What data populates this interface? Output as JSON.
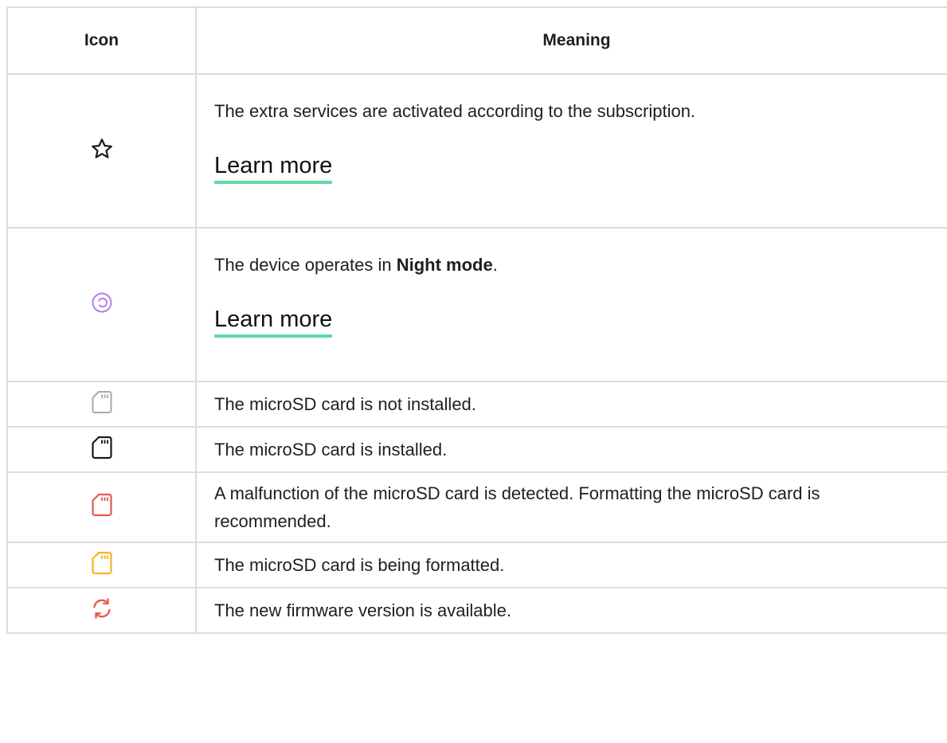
{
  "table": {
    "header": {
      "icon": "Icon",
      "meaning": "Meaning"
    },
    "rows": [
      {
        "icon": "star-outline-icon",
        "text": "The extra services are activated according to the subscription.",
        "link": "Learn more"
      },
      {
        "icon": "night-mode-icon",
        "text_prefix": "The device operates in ",
        "text_bold": "Night mode",
        "text_suffix": ".",
        "link": "Learn more"
      },
      {
        "icon": "microsd-not-installed-icon",
        "text": "The microSD card is not installed."
      },
      {
        "icon": "microsd-installed-icon",
        "text": "The microSD card is installed."
      },
      {
        "icon": "microsd-malfunction-icon",
        "text": "A malfunction of the microSD card is detected. Formatting the microSD card is recommended."
      },
      {
        "icon": "microsd-formatting-icon",
        "text": "The microSD card is being formatted."
      },
      {
        "icon": "firmware-update-icon",
        "text": "The new firmware version is available."
      }
    ]
  },
  "colors": {
    "border": "#dcdcdc",
    "link_underline": "#5fdca2",
    "night_icon": "#b57ee8",
    "sd_grey": "#a8a8a8",
    "sd_black": "#1a1a1a",
    "sd_red": "#e05a4e",
    "sd_yellow": "#f2b71f",
    "firmware_red": "#ee5a4c"
  }
}
